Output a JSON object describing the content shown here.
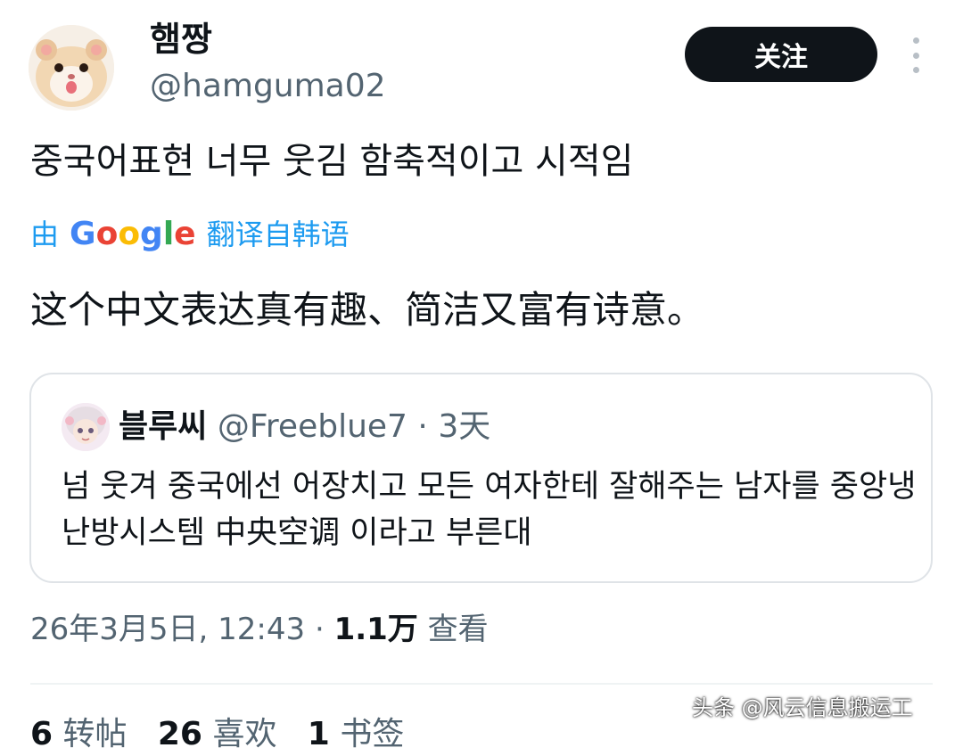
{
  "author": {
    "display_name": "햄짱",
    "handle": "@hamguma02"
  },
  "follow_button_label": "关注",
  "tweet_text": "중국어표현 너무 웃김 함축적이고 시적임",
  "translation": {
    "prefix": "由",
    "provider": "Google",
    "suffix": "翻译自韩语",
    "text": "这个中文表达真有趣、简洁又富有诗意。"
  },
  "quoted_tweet": {
    "display_name": "블루씨",
    "handle": "@Freeblue7",
    "separator": "·",
    "time": "3天",
    "text": "넘 웃겨 중국에선 어장치고 모든 여자한테 잘해주는 남자를 중앙냉난방시스템 中央空调 이라고 부른대"
  },
  "meta": {
    "timestamp": "26年3月5日, 12:43",
    "separator": "·",
    "views_count": "1.1万",
    "views_label": "查看"
  },
  "stats": {
    "reposts_count": "6",
    "reposts_label": "转帖",
    "likes_count": "26",
    "likes_label": "喜欢",
    "bookmarks_count": "1",
    "bookmarks_label": "书签"
  },
  "watermark": "头条 @风云信息搬运工",
  "icons": [
    "hamster-avatar",
    "more-options-icon",
    "anime-avatar"
  ],
  "colors": {
    "accent": "#1d9bf0",
    "text": "#0f1419",
    "muted": "#536471",
    "button_bg": "#0f1419"
  }
}
